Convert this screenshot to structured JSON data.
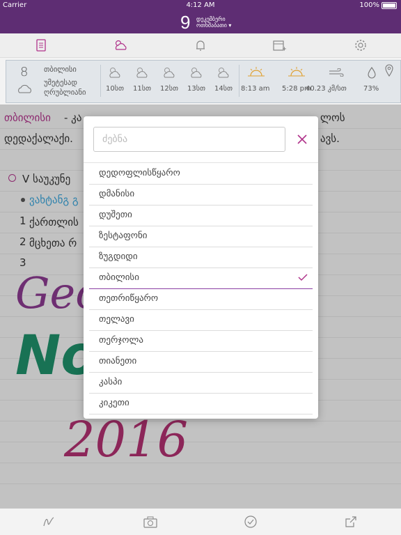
{
  "status_bar": {
    "carrier": "Carrier",
    "time": "4:12 AM",
    "battery": "100%"
  },
  "header": {
    "day": "9",
    "month": "დეკემბერი",
    "weekday": "ოთხშაბათი ▾"
  },
  "toolbar": {
    "icons": [
      "note-icon",
      "weather-icon",
      "bell-icon",
      "calendar-add-icon",
      "gear-icon"
    ]
  },
  "weather": {
    "current_temp": "8",
    "city": "თბილისი",
    "condition_line1": "უმეტესად",
    "condition_line2": "ღრუბლიანი",
    "hours": [
      "10სთ",
      "11სთ",
      "12სთ",
      "13სთ",
      "14სთ"
    ],
    "sunrise": "8:13 am",
    "sunset": "5:28 pm",
    "wind": "40.23 კმ/სთ",
    "humidity": "73%"
  },
  "note": {
    "line1_link": "თბილისი",
    "line1_rest": "- კა",
    "line1_tail": "ლოს",
    "line2_start": "დედაქალაქი.",
    "line2_tail": "ავს.",
    "bullet_item": "V საუკუნე",
    "sub_link": "ვახტანგ გ",
    "item1": "ქართლის",
    "item2": "მცხეთა რ",
    "num1": "1",
    "num2": "2",
    "num3": "3",
    "handwriting1": "Geo",
    "handwriting2": "Note",
    "handwriting3": "2016"
  },
  "picker": {
    "search_placeholder": "ძებნა",
    "items": [
      {
        "label": "დედოფლისწყარო",
        "selected": false
      },
      {
        "label": "დმანისი",
        "selected": false
      },
      {
        "label": "დუშეთი",
        "selected": false
      },
      {
        "label": "ზესტაფონი",
        "selected": false
      },
      {
        "label": "ზუგდიდი",
        "selected": false
      },
      {
        "label": "თბილისი",
        "selected": true
      },
      {
        "label": "თეთრიწყარო",
        "selected": false
      },
      {
        "label": "თელავი",
        "selected": false
      },
      {
        "label": "თერჯოლა",
        "selected": false
      },
      {
        "label": "თიანეთი",
        "selected": false
      },
      {
        "label": "კასპი",
        "selected": false
      },
      {
        "label": "კიკეთი",
        "selected": false
      }
    ]
  },
  "colors": {
    "brand": "#5e2d73",
    "accent": "#b0338a",
    "link": "#3aa3d8",
    "selection_line": "#8a3fa3",
    "ink_green": "#1f8f6a",
    "ink_purple": "#8a3a8f",
    "ink_pink": "#b03070"
  }
}
